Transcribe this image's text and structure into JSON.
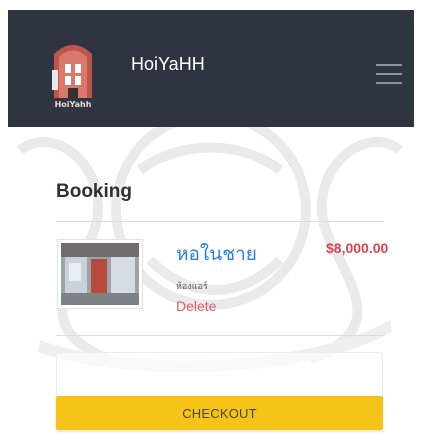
{
  "header": {
    "brand": "HoiYaHH",
    "logo_caption": "HoiYahh",
    "menu_icon": "hamburger-menu-icon"
  },
  "booking": {
    "heading": "Booking",
    "items": [
      {
        "title": "หอในชาย",
        "subtitle": "ห้องแอร์",
        "price": "$8,000.00",
        "delete_label": "Delete",
        "thumbnail_icon": "room-photo"
      }
    ],
    "checkout_label": "CHECKOUT"
  },
  "colors": {
    "navbar": "#2e3541",
    "accent_blue": "#2a7fe0",
    "price_red": "#d94451",
    "checkout_yellow": "#f6c416"
  }
}
